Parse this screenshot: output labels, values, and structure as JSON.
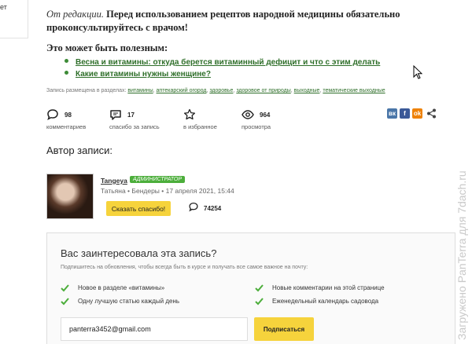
{
  "left_stub": {
    "text": "ет"
  },
  "editor_note": {
    "prefix": "От редакции.",
    "text": " Перед использованием рецептов народной медицины обязательно проконсультируйтесь с врачом!"
  },
  "useful": {
    "title": "Это может быть полезным:",
    "links": [
      "Весна и витамины: откуда берется витаминный дефицит и что с этим делать",
      "Какие витамины нужны женщине?"
    ]
  },
  "tags": {
    "prefix": "Запись размещена в разделах: ",
    "items": [
      "витамины",
      "аптекарский огород",
      "здоровье",
      "здоровое от природы",
      "выходные",
      "тематические выходные"
    ],
    "separator": ", "
  },
  "stats": [
    {
      "icon": "comment-icon",
      "value": "98",
      "label": "комментариев"
    },
    {
      "icon": "speech-bubble-icon",
      "value": "17",
      "label": "спасибо за запись"
    },
    {
      "icon": "star-icon",
      "value": "",
      "label": "в избранное"
    },
    {
      "icon": "eye-icon",
      "value": "964",
      "label": "просмотра"
    }
  ],
  "share": {
    "buttons": [
      {
        "icon": "vk-icon",
        "glyph": "вк",
        "color": "#4a76a8"
      },
      {
        "icon": "facebook-icon",
        "glyph": "f",
        "color": "#3b5998"
      },
      {
        "icon": "odnoklassniki-icon",
        "glyph": "ok",
        "color": "#ee8208"
      }
    ],
    "more_icon": "share-icon"
  },
  "author": {
    "heading": "Автор записи:",
    "username": "Tangeya",
    "badge": "Администратор",
    "meta": "Татьяна • Бендеры • 17 апреля 2021, 15:44",
    "thanks_label": "Сказать спасибо!",
    "thanks_count": "74254"
  },
  "subscribe": {
    "title": "Вас заинтересовала эта запись?",
    "description": "Подпишитесь на обновления, чтобы всегда быть в курсе и получать все самое важное на почту:",
    "options": [
      "Новое в разделе «витамины»",
      "Новые комментарии на этой странице",
      "Одну лучшую статью каждый день",
      "Еженедельный календарь садовода"
    ],
    "email_value": "panterra3452@gmail.com",
    "button_label": "Подписаться"
  },
  "watermark": "Загружено PanTerra для 7dach.ru",
  "colors": {
    "accent_green": "#4cae3b",
    "link_green": "#2f6f2a",
    "button_yellow": "#f6d33c"
  }
}
